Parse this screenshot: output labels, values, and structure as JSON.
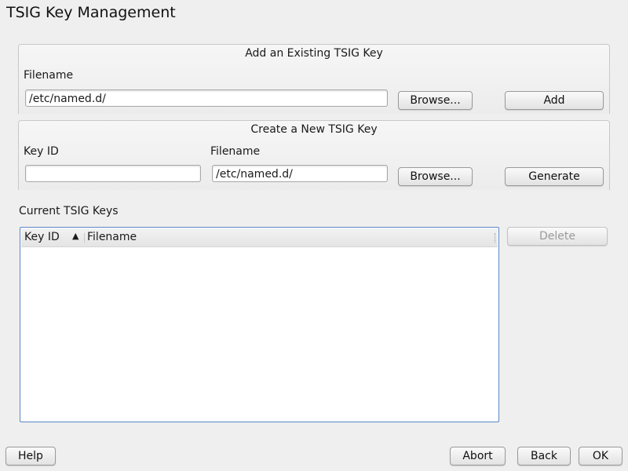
{
  "window": {
    "title": "TSIG Key Management"
  },
  "add_existing": {
    "title": "Add an Existing TSIG Key",
    "filename_label": "Filename",
    "filename_value": "/etc/named.d/",
    "browse_label": "Browse...",
    "add_label": "Add"
  },
  "create_new": {
    "title": "Create a New TSIG Key",
    "keyid_label": "Key ID",
    "keyid_value": "",
    "filename_label": "Filename",
    "filename_value": "/etc/named.d/",
    "browse_label": "Browse...",
    "generate_label": "Generate"
  },
  "current_keys": {
    "label": "Current TSIG Keys",
    "columns": [
      "Key ID",
      "Filename"
    ],
    "rows": [],
    "delete_label": "Delete"
  },
  "footer": {
    "help_label": "Help",
    "abort_label": "Abort",
    "back_label": "Back",
    "ok_label": "OK"
  }
}
